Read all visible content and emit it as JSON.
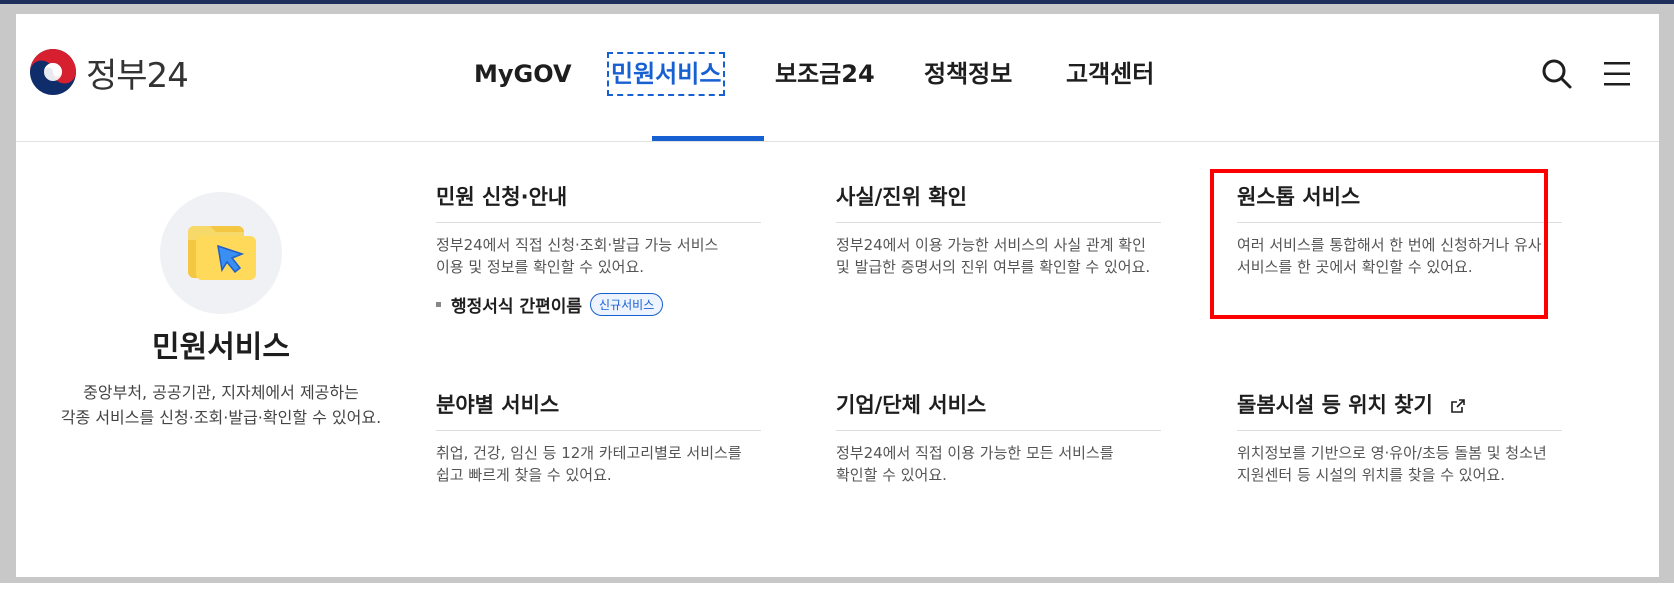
{
  "logo": {
    "text": "정부24"
  },
  "nav": {
    "items": [
      {
        "label": "MyGOV",
        "active": false
      },
      {
        "label": "민원서비스",
        "active": true
      },
      {
        "label": "보조금24",
        "active": false
      },
      {
        "label": "정책정보",
        "active": false
      },
      {
        "label": "고객센터",
        "active": false
      }
    ]
  },
  "intro": {
    "title": "민원서비스",
    "desc_line1": "중앙부처, 공공기관, 지자체에서 제공하는",
    "desc_line2": "각종 서비스를 신청·조회·발급·확인할 수 있어요."
  },
  "cards": [
    {
      "title": "민원 신청·안내",
      "desc_line1": "정부24에서 직접 신청·조회·발급 가능 서비스",
      "desc_line2": "이용 및 정보를 확인할 수 있어요.",
      "sub": "행정서식 간편이름",
      "badge": "신규서비스"
    },
    {
      "title": "사실/진위 확인",
      "desc_line1": "정부24에서 이용 가능한 서비스의 사실 관계 확인",
      "desc_line2": "및 발급한 증명서의 진위 여부를 확인할 수 있어요."
    },
    {
      "title": "원스톱 서비스",
      "desc_line1": "여러 서비스를 통합해서 한 번에 신청하거나 유사",
      "desc_line2": "서비스를 한 곳에서 확인할 수 있어요."
    },
    {
      "title": "분야별 서비스",
      "desc_line1": "취업, 건강, 임신 등 12개 카테고리별로 서비스를",
      "desc_line2": "쉽고 빠르게 찾을 수 있어요."
    },
    {
      "title": "기업/단체 서비스",
      "desc_line1": "정부24에서 직접 이용 가능한 모든 서비스를",
      "desc_line2": "확인할 수 있어요."
    },
    {
      "title": "돌봄시설 등 위치 찾기",
      "desc_line1": "위치정보를 기반으로 영·유아/초등 돌봄 및 청소년",
      "desc_line2": "지원센터 등 시설의 위치를 찾을 수 있어요."
    }
  ],
  "colors": {
    "accent": "#1760d2",
    "highlight": "#ff0000"
  },
  "icons": [
    "search-icon",
    "menu-icon",
    "external-link-icon",
    "folder-cursor-icon",
    "taegeuk-logo-icon"
  ]
}
